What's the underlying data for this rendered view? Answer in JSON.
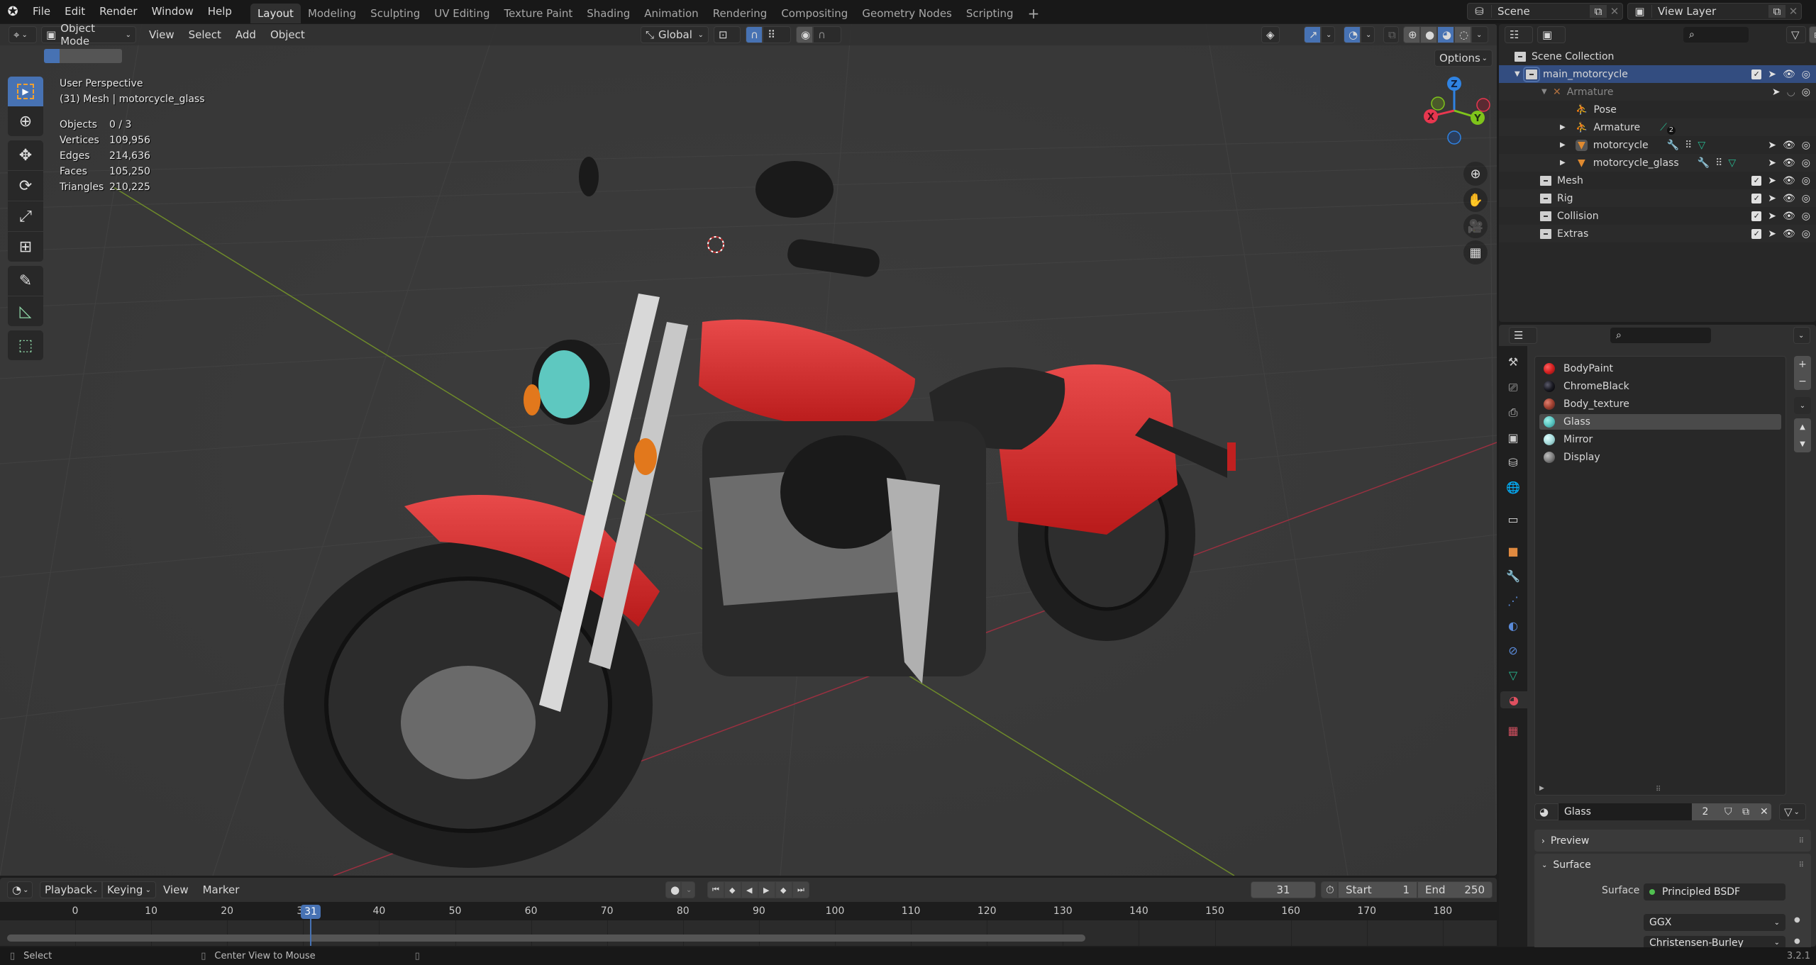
{
  "app": {
    "version": "3.2.1"
  },
  "topbar": {
    "menus": [
      "File",
      "Edit",
      "Render",
      "Window",
      "Help"
    ],
    "workspaces": [
      "Layout",
      "Modeling",
      "Sculpting",
      "UV Editing",
      "Texture Paint",
      "Shading",
      "Animation",
      "Rendering",
      "Compositing",
      "Geometry Nodes",
      "Scripting"
    ],
    "active_workspace": "Layout",
    "add_workspace": "+",
    "scene": "Scene",
    "view_layer": "View Layer"
  },
  "viewport": {
    "mode": "Object Mode",
    "menus": [
      "View",
      "Select",
      "Add",
      "Object"
    ],
    "transform_orientation": "Global",
    "options_label": "Options",
    "view_name": "User Perspective",
    "active_info": "(31) Mesh | motorcycle_glass",
    "stats": [
      {
        "label": "Objects",
        "value": "0 / 3"
      },
      {
        "label": "Vertices",
        "value": "109,956"
      },
      {
        "label": "Edges",
        "value": "214,636"
      },
      {
        "label": "Faces",
        "value": "105,250"
      },
      {
        "label": "Triangles",
        "value": "210,225"
      }
    ],
    "tools": [
      "select-box-icon",
      "cursor-icon",
      "move-icon",
      "rotate-icon",
      "scale-icon",
      "transform-icon",
      "annotate-icon",
      "measure-icon",
      "add-cube-icon"
    ],
    "gizmo": {
      "x": "X",
      "y": "Y",
      "z": "Z",
      "x_color": "#e8374f",
      "y_color": "#7fc41b",
      "z_color": "#2f83e3"
    }
  },
  "outliner": {
    "root": "Scene Collection",
    "rows": [
      {
        "label": "main_motorcycle",
        "type": "collection",
        "selected": true
      },
      {
        "label": "Armature",
        "type": "armature",
        "dimmed": true
      },
      {
        "label": "Pose",
        "type": "pose"
      },
      {
        "label": "Armature",
        "type": "armature-data",
        "badge": "2"
      },
      {
        "label": "motorcycle",
        "type": "mesh"
      },
      {
        "label": "motorcycle_glass",
        "type": "mesh"
      },
      {
        "label": "Mesh",
        "type": "collection"
      },
      {
        "label": "Rig",
        "type": "collection"
      },
      {
        "label": "Collision",
        "type": "collection"
      },
      {
        "label": "Extras",
        "type": "collection"
      }
    ]
  },
  "properties": {
    "materials": [
      {
        "name": "BodyPaint",
        "color": "#d42020"
      },
      {
        "name": "ChromeBlack",
        "color": "#1a1a22"
      },
      {
        "name": "Body_texture",
        "color": "#a04030"
      },
      {
        "name": "Glass",
        "color": "#5cc8c4",
        "selected": true
      },
      {
        "name": "Mirror",
        "color": "#a8dcdc"
      },
      {
        "name": "Display",
        "color": "#808080"
      }
    ],
    "active_material": "Glass",
    "user_count": "2",
    "panels": {
      "preview": "Preview",
      "surface": "Surface"
    },
    "surface_label": "Surface",
    "surface_value": "Principled BSDF",
    "distribution": "GGX",
    "subsurface_method": "Christensen-Burley"
  },
  "timeline": {
    "menus": [
      "Playback",
      "Keying",
      "View",
      "Marker"
    ],
    "current_frame": "31",
    "start_label": "Start",
    "start": "1",
    "end_label": "End",
    "end": "250",
    "ticks": [
      "0",
      "10",
      "20",
      "30",
      "40",
      "50",
      "60",
      "70",
      "80",
      "90",
      "100",
      "110",
      "120",
      "130",
      "140",
      "150",
      "160",
      "170",
      "180"
    ]
  },
  "statusbar": {
    "hints": [
      "Select",
      "Center View to Mouse"
    ],
    "version": "3.2.1"
  }
}
